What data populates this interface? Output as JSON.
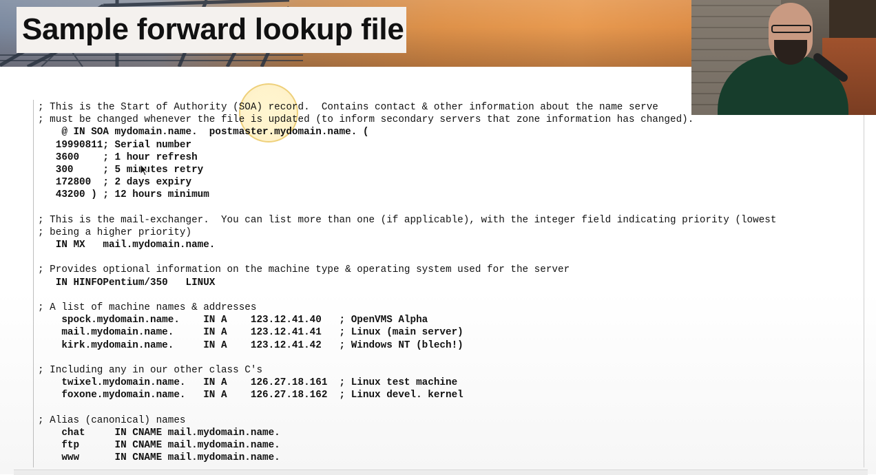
{
  "slide": {
    "title": "Sample forward lookup file",
    "lines": [
      {
        "text": "; This is the Start of Authority (SOA) record.  Contains contact & other information about the name serve",
        "bold": false
      },
      {
        "text": "; must be changed whenever the file is updated (to inform secondary servers that zone information has changed).",
        "bold": false
      },
      {
        "text": "    @ IN SOA mydomain.name.  postmaster.mydomain.name. (",
        "bold": true
      },
      {
        "text": "   19990811; Serial number",
        "bold": true
      },
      {
        "text": "   3600    ; 1 hour refresh",
        "bold": true
      },
      {
        "text": "   300     ; 5 minutes retry",
        "bold": true
      },
      {
        "text": "   172800  ; 2 days expiry",
        "bold": true
      },
      {
        "text": "   43200 ) ; 12 hours minimum",
        "bold": true
      },
      {
        "text": "",
        "bold": false
      },
      {
        "text": "; This is the mail-exchanger.  You can list more than one (if applicable), with the integer field indicating priority (lowest",
        "bold": false
      },
      {
        "text": "; being a higher priority)",
        "bold": false
      },
      {
        "text": "   IN MX   mail.mydomain.name.",
        "bold": true
      },
      {
        "text": "",
        "bold": false
      },
      {
        "text": "; Provides optional information on the machine type & operating system used for the server",
        "bold": false
      },
      {
        "text": "   IN HINFOPentium/350   LINUX",
        "bold": true
      },
      {
        "text": "",
        "bold": false
      },
      {
        "text": "; A list of machine names & addresses",
        "bold": false
      },
      {
        "text": "    spock.mydomain.name.    IN A    123.12.41.40   ; OpenVMS Alpha",
        "bold": true
      },
      {
        "text": "    mail.mydomain.name.     IN A    123.12.41.41   ; Linux (main server)",
        "bold": true
      },
      {
        "text": "    kirk.mydomain.name.     IN A    123.12.41.42   ; Windows NT (blech!)",
        "bold": true
      },
      {
        "text": "",
        "bold": false
      },
      {
        "text": "; Including any in our other class C's",
        "bold": false
      },
      {
        "text": "    twixel.mydomain.name.   IN A    126.27.18.161  ; Linux test machine",
        "bold": true
      },
      {
        "text": "    foxone.mydomain.name.   IN A    126.27.18.162  ; Linux devel. kernel",
        "bold": true
      },
      {
        "text": "",
        "bold": false
      },
      {
        "text": "; Alias (canonical) names",
        "bold": false
      },
      {
        "text": "    chat     IN CNAME mail.mydomain.name.",
        "bold": true
      },
      {
        "text": "    ftp      IN CNAME mail.mydomain.name.",
        "bold": true
      },
      {
        "text": "    www      IN CNAME mail.mydomain.name.",
        "bold": true
      }
    ]
  },
  "colors": {
    "highlight": "#f5d98a",
    "text": "#111111",
    "banner_accent": "#de9149"
  },
  "icons": {
    "cursor": "mouse-pointer-icon"
  }
}
